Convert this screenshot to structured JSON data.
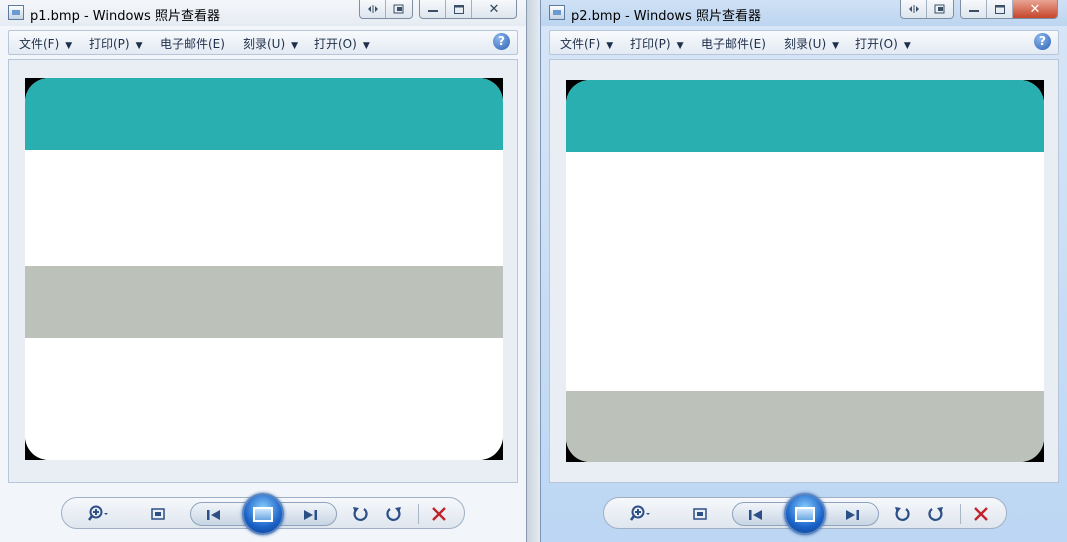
{
  "windows": [
    {
      "title": "p1.bmp - Windows 照片查看器",
      "menu": [
        {
          "label": "文件(F)",
          "has_dropdown": true
        },
        {
          "label": "打印(P)",
          "has_dropdown": true
        },
        {
          "label": "电子邮件(E)",
          "has_dropdown": false
        },
        {
          "label": "刻录(U)",
          "has_dropdown": true
        },
        {
          "label": "打开(O)",
          "has_dropdown": true
        }
      ],
      "image": {
        "bands": [
          {
            "color": "#2aafb0",
            "fraction": 0.188
          },
          {
            "color": "#ffffff",
            "fraction": 0.304
          },
          {
            "color": "#bcc2b9",
            "fraction": 0.188
          },
          {
            "color": "#ffffff",
            "fraction": 0.32
          }
        ]
      }
    },
    {
      "title": "p2.bmp - Windows 照片查看器",
      "menu": [
        {
          "label": "文件(F)",
          "has_dropdown": true
        },
        {
          "label": "打印(P)",
          "has_dropdown": true
        },
        {
          "label": "电子邮件(E)",
          "has_dropdown": false
        },
        {
          "label": "刻录(U)",
          "has_dropdown": true
        },
        {
          "label": "打开(O)",
          "has_dropdown": true
        }
      ],
      "image": {
        "bands": [
          {
            "color": "#2aafb0",
            "fraction": 0.188
          },
          {
            "color": "#ffffff",
            "fraction": 0.626
          },
          {
            "color": "#bcc2b9",
            "fraction": 0.186
          }
        ]
      }
    }
  ],
  "icons": {
    "dropdown_arrow": "▼",
    "help": "?",
    "close": "✕"
  },
  "colors": {
    "teal": "#2aafb0",
    "gray": "#bcc2b9",
    "delete_red": "#c0232b",
    "nav_blue": "#2c4f86"
  }
}
